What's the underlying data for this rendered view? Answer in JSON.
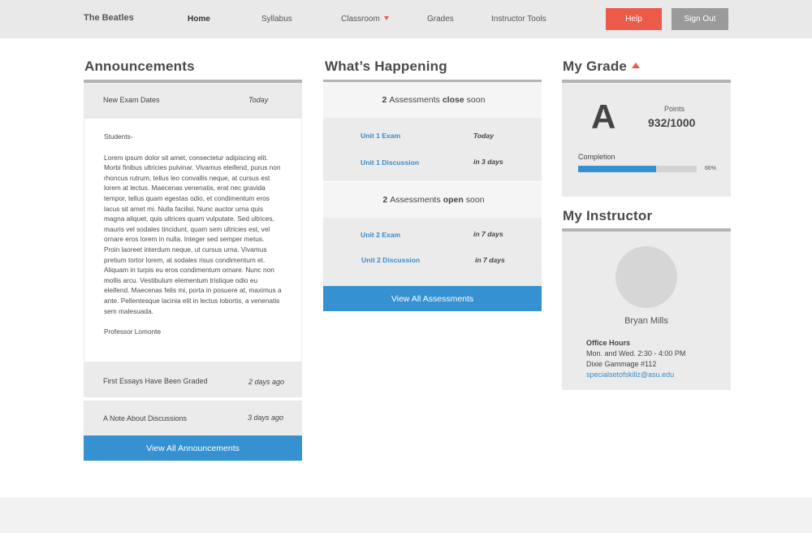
{
  "nav": {
    "brand": "The Beatles",
    "links": [
      "Home",
      "Syllabus",
      "Classroom",
      "Grades",
      "Instructor Tools"
    ],
    "help_label": "Help",
    "signout_label": "Sign Out"
  },
  "announcements": {
    "title": "Announcements",
    "items": [
      {
        "title": "New Exam Dates",
        "date": "Today"
      },
      {
        "title": "First Essays Have Been Graded",
        "date": "2 days ago"
      },
      {
        "title": "A Note About Discussions",
        "date": "3 days ago"
      }
    ],
    "body": {
      "greeting": "Students-",
      "text": "Lorem ipsum dolor sit amet, consectetur adipiscing elit. Morbi finibus ultricies pulvinar. Vivamus eleifend, purus non rhoncus rutrum, tellus leo convallis neque, at cursus est lorem at lectus. Maecenas venenatis, erat nec gravida tempor, tellus quam egestas odio, et condimentum eros lacus sit amet mi. Nulla facilisi. Nunc auctor urna quis magna aliquet, quis ultrices quam vulputate. Sed ultrices, mauris vel sodales tincidunt, quam sem ultricies est, vel ornare eros lorem in nulla. Integer sed semper metus. Proin laoreet interdum neque, ut cursus urna. Vivamus pretium tortor lorem, at sodales risus condimentum et. Aliquam in turpis eu eros condimentum ornare. Nunc non mollis arcu. Vestibulum elementum tristique odio eu eleifend. Maecenas felis mi, porta in posuere at, maximus a ante. Pellentesque lacinia elit in lectus lobortis, a venenatis sem malesuada.",
      "signature": "Professor Lomonte"
    },
    "view_all_label": "View All Announcements"
  },
  "happening": {
    "title": "What’s Happening",
    "close": {
      "count": "2",
      "pre": "Assessments",
      "keyword": "close",
      "post": "soon",
      "items": [
        {
          "name": "Unit 1 Exam",
          "when": "Today"
        },
        {
          "name": "Unit 1 Discussion",
          "when": "in 3 days"
        }
      ]
    },
    "open": {
      "count": "2",
      "pre": "Assessments",
      "keyword": "open",
      "post": "soon",
      "items": [
        {
          "name": "Unit 2 Exam",
          "when": "in 7 days"
        },
        {
          "name": "Unit 2 Discussion",
          "when": "in 7 days"
        }
      ]
    },
    "view_all_label": "View All Assessments"
  },
  "grade": {
    "title": "My Grade",
    "letter": "A",
    "points_label": "Points",
    "points_value": "932/1000",
    "completion_label": "Completion",
    "completion_fraction": 0.66,
    "completion_text": "66%"
  },
  "instructor": {
    "title": "My Instructor",
    "name": "Bryan Mills",
    "office_hours_label": "Office Hours",
    "hours": "Mon. and Wed. 2:30 - 4:00 PM",
    "location": "Dixie Gammage #112",
    "email": "specialsetofskillz@asu.edu"
  },
  "colors": {
    "accent_blue": "#3591d0",
    "accent_red": "#ec5a4a",
    "panel_gray": "#ebebeb"
  }
}
